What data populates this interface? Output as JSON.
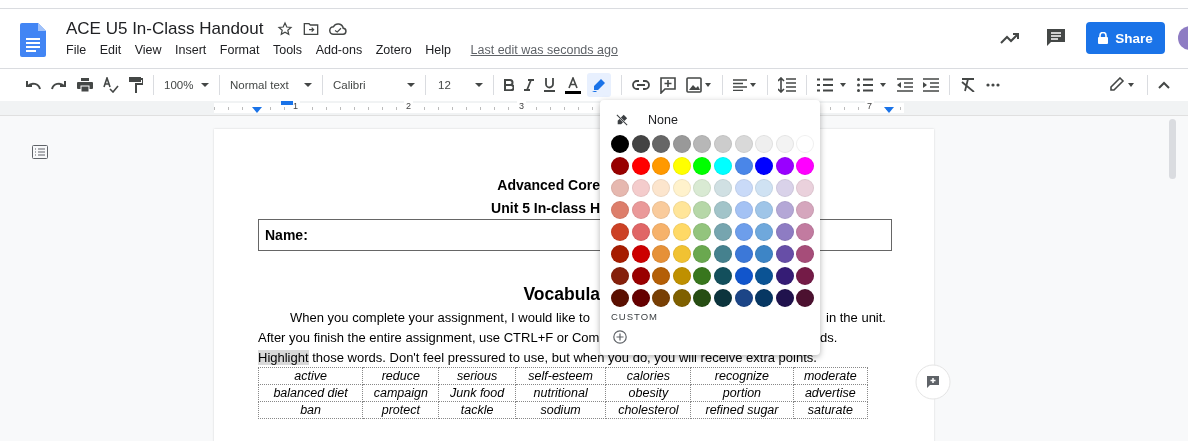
{
  "title": "ACE U5 In-Class Handout",
  "menu": [
    "File",
    "Edit",
    "View",
    "Insert",
    "Format",
    "Tools",
    "Add-ons",
    "Zotero",
    "Help"
  ],
  "last_edit": "Last edit was seconds ago",
  "share": {
    "label": "Share"
  },
  "toolbar": {
    "zoom": "100%",
    "style": "Normal text",
    "font": "Calibri",
    "size": "12",
    "highlight_selected": true
  },
  "ruler": [
    "1",
    "2",
    "3",
    "7"
  ],
  "document": {
    "heading_1": "Advanced Core",
    "heading_2": "Unit 5 In-class H",
    "name_label": "Name:",
    "section_title": "Vocabula",
    "para_1": {
      "left": "When you complete your assignment, I would like to",
      "right": "in the unit."
    },
    "para_2": {
      "left": "After you finish the entire assignment, use CTRL+F or Com",
      "right": "ds."
    },
    "para_3": [
      {
        "text": "Highlight",
        "highlighted": true
      },
      {
        "text": " those words. Don't feel pressured to use, but when you do, you will receive extra points.",
        "highlighted": false
      }
    ],
    "table": {
      "rows": [
        [
          "active",
          "reduce",
          "serious",
          "self-esteem",
          "calories",
          "recognize",
          "moderate"
        ],
        [
          "balanced diet",
          "campaign",
          "Junk food",
          "nutritional",
          "obesity",
          "portion",
          "advertise"
        ],
        [
          "ban",
          "protect",
          "tackle",
          "sodium",
          "cholesterol",
          "refined sugar",
          "saturate"
        ]
      ]
    }
  },
  "palette": {
    "none_label": "None",
    "custom_label": "CUSTOM",
    "swatch_rows": [
      {
        "swatches": [
          {
            "color": "#000000"
          },
          {
            "color": "#434343"
          },
          {
            "color": "#666666"
          },
          {
            "color": "#999999"
          },
          {
            "color": "#b7b7b7"
          },
          {
            "color": "#cccccc"
          },
          {
            "color": "#d9d9d9"
          },
          {
            "color": "#efefef"
          },
          {
            "color": "#f3f3f3"
          },
          {
            "color": "#ffffff"
          }
        ]
      },
      {
        "swatches": [
          {
            "color": "#980000"
          },
          {
            "color": "#ff0000"
          },
          {
            "color": "#ff9900"
          },
          {
            "color": "#ffff00"
          },
          {
            "color": "#00ff00"
          },
          {
            "color": "#00ffff"
          },
          {
            "color": "#4a86e8"
          },
          {
            "color": "#0000ff"
          },
          {
            "color": "#9900ff"
          },
          {
            "color": "#ff00ff"
          }
        ]
      },
      {
        "swatches": [
          {
            "color": "#e6b8af"
          },
          {
            "color": "#f4cccc"
          },
          {
            "color": "#fce5cd"
          },
          {
            "color": "#fff2cc"
          },
          {
            "color": "#d9ead3"
          },
          {
            "color": "#d0e0e3"
          },
          {
            "color": "#c9daf8"
          },
          {
            "color": "#cfe2f3"
          },
          {
            "color": "#d9d2e9"
          },
          {
            "color": "#ead1dc"
          }
        ]
      },
      {
        "swatches": [
          {
            "color": "#dd7e6b"
          },
          {
            "color": "#ea9999"
          },
          {
            "color": "#f9cb9c"
          },
          {
            "color": "#ffe599"
          },
          {
            "color": "#b6d7a8"
          },
          {
            "color": "#a2c4c9"
          },
          {
            "color": "#a4c2f4"
          },
          {
            "color": "#9fc5e8"
          },
          {
            "color": "#b4a7d6"
          },
          {
            "color": "#d5a6bd"
          }
        ]
      },
      {
        "swatches": [
          {
            "color": "#cc4125"
          },
          {
            "color": "#e06666"
          },
          {
            "color": "#f6b26b"
          },
          {
            "color": "#ffd966"
          },
          {
            "color": "#93c47d"
          },
          {
            "color": "#76a5af"
          },
          {
            "color": "#6d9eeb"
          },
          {
            "color": "#6fa8dc"
          },
          {
            "color": "#8e7cc3"
          },
          {
            "color": "#c27ba0"
          }
        ]
      },
      {
        "swatches": [
          {
            "color": "#a61c00"
          },
          {
            "color": "#cc0000"
          },
          {
            "color": "#e69138"
          },
          {
            "color": "#f1c232"
          },
          {
            "color": "#6aa84f"
          },
          {
            "color": "#45818e"
          },
          {
            "color": "#3c78d8"
          },
          {
            "color": "#3d85c6"
          },
          {
            "color": "#674ea7"
          },
          {
            "color": "#a64d79"
          }
        ]
      },
      {
        "swatches": [
          {
            "color": "#85200c"
          },
          {
            "color": "#990000"
          },
          {
            "color": "#b45f06"
          },
          {
            "color": "#bf9000"
          },
          {
            "color": "#38761d"
          },
          {
            "color": "#134f5c"
          },
          {
            "color": "#1155cc"
          },
          {
            "color": "#0b5394"
          },
          {
            "color": "#351c75"
          },
          {
            "color": "#741b47"
          }
        ]
      },
      {
        "swatches": [
          {
            "color": "#5b0f00"
          },
          {
            "color": "#660000"
          },
          {
            "color": "#783f04"
          },
          {
            "color": "#7f6000"
          },
          {
            "color": "#274e13"
          },
          {
            "color": "#0c343d"
          },
          {
            "color": "#1c4587"
          },
          {
            "color": "#073763"
          },
          {
            "color": "#20124d"
          },
          {
            "color": "#4c1130"
          }
        ]
      }
    ]
  }
}
